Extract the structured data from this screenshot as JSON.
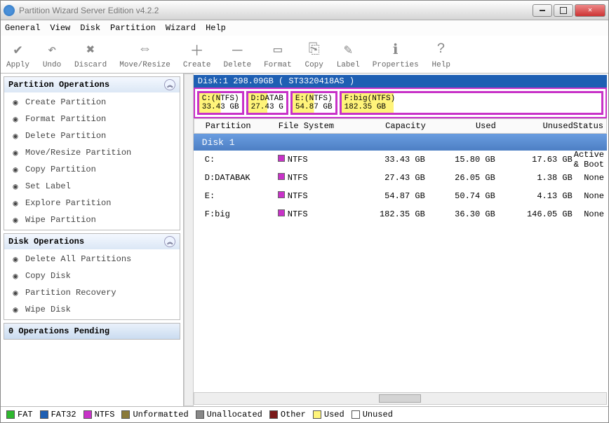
{
  "window": {
    "title": "Partition Wizard Server Edition v4.2.2"
  },
  "menu": [
    "General",
    "View",
    "Disk",
    "Partition",
    "Wizard",
    "Help"
  ],
  "toolbar": [
    {
      "label": "Apply",
      "glyph": "✔"
    },
    {
      "label": "Undo",
      "glyph": "↶"
    },
    {
      "label": "Discard",
      "glyph": "✖"
    },
    {
      "label": "Move/Resize",
      "glyph": "⇔"
    },
    {
      "label": "Create",
      "glyph": "＋"
    },
    {
      "label": "Delete",
      "glyph": "－"
    },
    {
      "label": "Format",
      "glyph": "▭"
    },
    {
      "label": "Copy",
      "glyph": "⎘"
    },
    {
      "label": "Label",
      "glyph": "✎"
    },
    {
      "label": "Properties",
      "glyph": "ℹ"
    },
    {
      "label": "Help",
      "glyph": "?"
    }
  ],
  "sidebar": {
    "partition_ops": {
      "title": "Partition Operations",
      "items": [
        "Create Partition",
        "Format Partition",
        "Delete Partition",
        "Move/Resize Partition",
        "Copy Partition",
        "Set Label",
        "Explore Partition",
        "Wipe Partition"
      ]
    },
    "disk_ops": {
      "title": "Disk Operations",
      "items": [
        "Delete All Partitions",
        "Copy Disk",
        "Partition Recovery",
        "Wipe Disk"
      ]
    },
    "pending": {
      "title": "0 Operations Pending"
    }
  },
  "disk": {
    "header": "Disk:1 298.09GB  ( ST3320418AS )",
    "partitions_map": [
      {
        "line1": "C:(NTFS)",
        "line2": "33.43 GB"
      },
      {
        "line1": "D:DATAB",
        "line2": "27.43 G"
      },
      {
        "line1": "E:(NTFS)",
        "line2": "54.87 GB"
      },
      {
        "line1": "F:big(NTFS)",
        "line2": "182.35 GB"
      }
    ],
    "columns": [
      "Partition",
      "File System",
      "Capacity",
      "Used",
      "Unused",
      "Status"
    ],
    "group": "Disk 1",
    "rows": [
      {
        "part": "C:",
        "fs": "NTFS",
        "cap": "33.43 GB",
        "used": "15.80 GB",
        "unused": "17.63 GB",
        "status": "Active & Boot"
      },
      {
        "part": "D:DATABAK",
        "fs": "NTFS",
        "cap": "27.43 GB",
        "used": "26.05 GB",
        "unused": "1.38 GB",
        "status": "None"
      },
      {
        "part": "E:",
        "fs": "NTFS",
        "cap": "54.87 GB",
        "used": "50.74 GB",
        "unused": "4.13 GB",
        "status": "None"
      },
      {
        "part": "F:big",
        "fs": "NTFS",
        "cap": "182.35 GB",
        "used": "36.30 GB",
        "unused": "146.05 GB",
        "status": "None"
      }
    ]
  },
  "legend": [
    {
      "label": "FAT",
      "color": "#2eb82e"
    },
    {
      "label": "FAT32",
      "color": "#1e5fb3"
    },
    {
      "label": "NTFS",
      "color": "#c832c8"
    },
    {
      "label": "Unformatted",
      "color": "#8a7a3a"
    },
    {
      "label": "Unallocated",
      "color": "#888"
    },
    {
      "label": "Other",
      "color": "#7a1a1a"
    },
    {
      "label": "Used",
      "color": "#fff47a"
    },
    {
      "label": "Unused",
      "color": "#fff"
    }
  ]
}
